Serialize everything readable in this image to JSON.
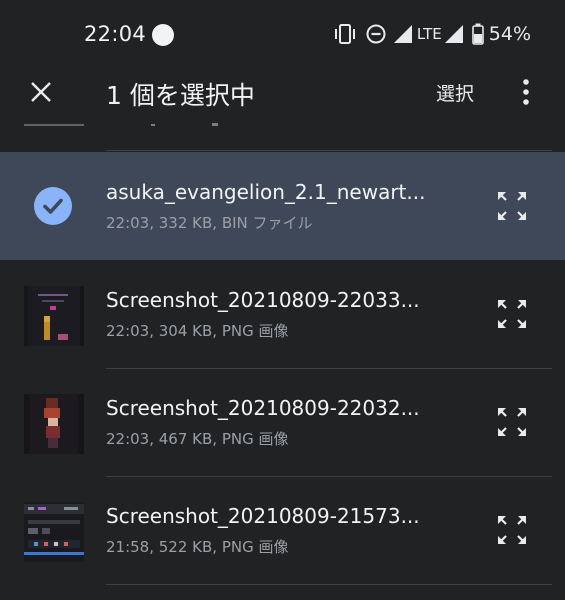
{
  "status_bar": {
    "time": "22:04",
    "network": "LTE",
    "battery": "54%",
    "icons": [
      "vibrate-icon",
      "do-not-disturb-icon",
      "signal-icon",
      "battery-icon"
    ]
  },
  "header": {
    "title": "1 個を選択中",
    "select_label": "選択",
    "close_icon": "close-icon",
    "more_icon": "more-vert-icon"
  },
  "files": [
    {
      "name": "asuka_evangelion_2.1_newart...",
      "meta": "22:03, 332 KB, BIN ファイル",
      "selected": true
    },
    {
      "name": "Screenshot_20210809-22033...",
      "meta": "22:03, 304 KB, PNG 画像",
      "selected": false
    },
    {
      "name": "Screenshot_20210809-22032...",
      "meta": "22:03, 467 KB, PNG 画像",
      "selected": false
    },
    {
      "name": "Screenshot_20210809-21573...",
      "meta": "21:58, 522 KB, PNG 画像",
      "selected": false
    }
  ],
  "colors": {
    "background": "#212224",
    "selected_row": "#3f4859",
    "accent": "#8ab4f8"
  }
}
